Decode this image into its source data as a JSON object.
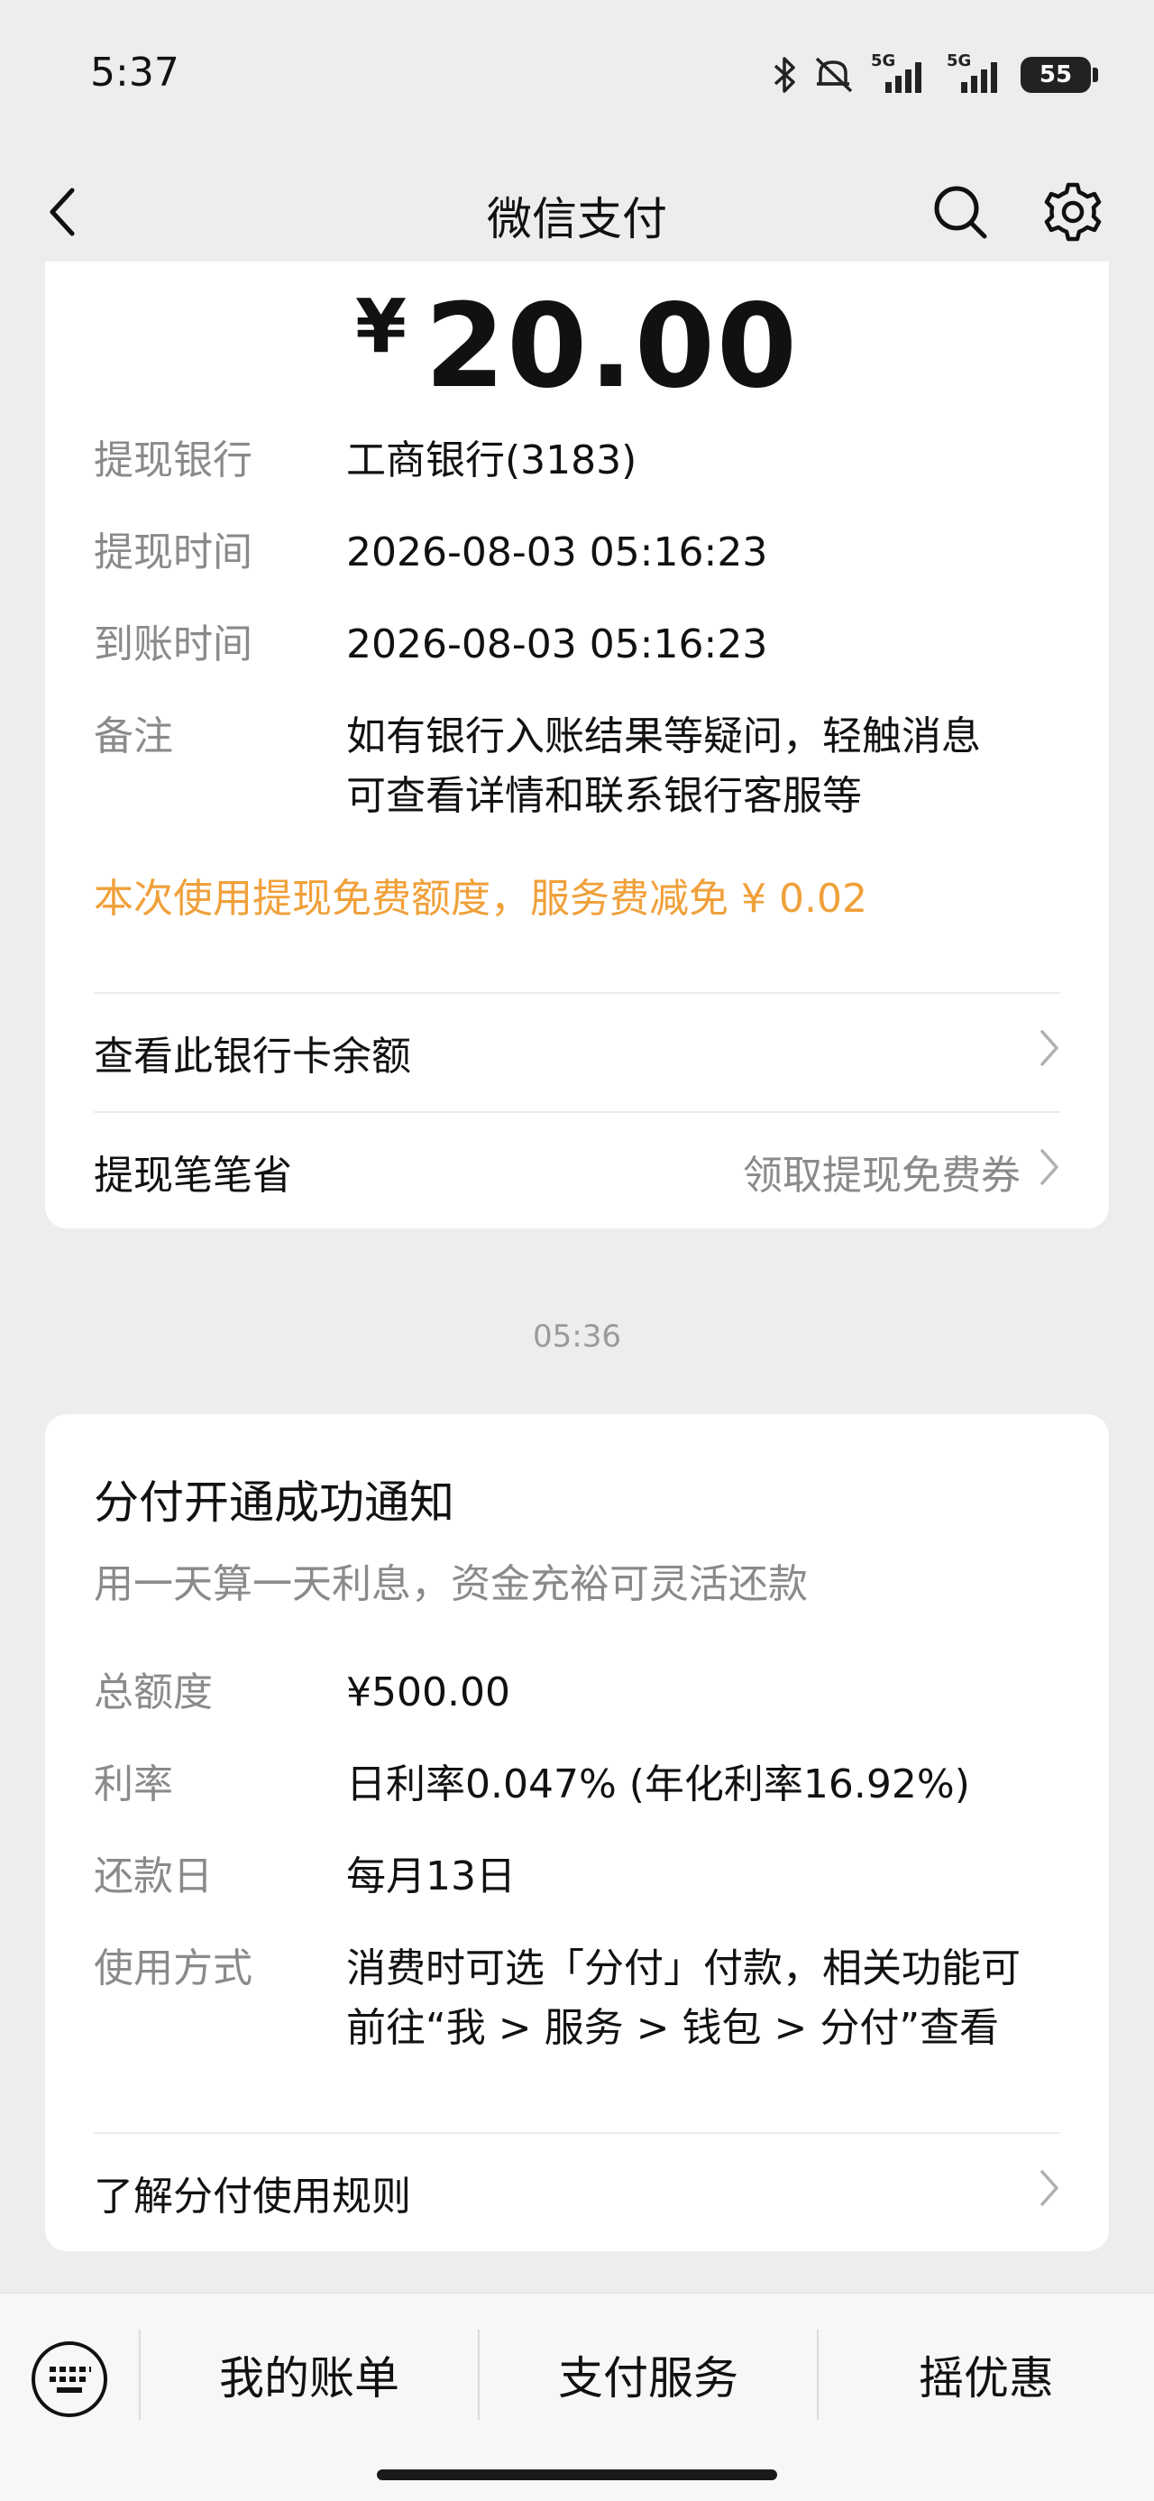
{
  "status_bar": {
    "time": "5:37",
    "battery": "55",
    "icons": [
      "bluetooth-icon",
      "mute-icon",
      "signal-5g-icon",
      "signal-5g-icon",
      "battery-icon"
    ],
    "signal_label": "5G"
  },
  "nav": {
    "title": "微信支付",
    "icons": [
      "back-icon",
      "search-icon",
      "gear-icon"
    ]
  },
  "withdraw_card": {
    "currency_symbol": "¥",
    "amount": "20.00",
    "rows": [
      {
        "label": "提现银行",
        "value": "工商银行(3183)"
      },
      {
        "label": "提现时间",
        "value": "2026-08-03 05:16:23"
      },
      {
        "label": "到账时间",
        "value": "2026-08-03 05:16:23"
      },
      {
        "label": "备注",
        "value_line1": "如有银行入账结果等疑问，轻触消息",
        "value_line2": "可查看详情和联系银行客服等"
      }
    ],
    "notice": "本次使用提现免费额度，服务费减免 ¥ 0.02",
    "notice_color": "#f0a03a",
    "link_balance": "查看此银行卡余额",
    "link_saver": "提现笔笔省",
    "link_saver_right": "领取提现免费券"
  },
  "timestamp": "05:36",
  "fenfu_card": {
    "title": "分付开通成功通知",
    "subtitle": "用一天算一天利息，资金充裕可灵活还款",
    "rows": [
      {
        "label": "总额度",
        "value": "¥500.00"
      },
      {
        "label": "利率",
        "value": "日利率0.047% (年化利率16.92%)"
      },
      {
        "label": "还款日",
        "value": "每月13日"
      },
      {
        "label": "使用方式",
        "value_line1": "消费时可选「分付」付款，相关功能可",
        "value_line2": "前往“我 > 服务 > 钱包 > 分付”查看"
      }
    ],
    "link_rules": "了解分付使用规则"
  },
  "tab_bar": {
    "keyboard_icon": "keyboard-icon",
    "items": [
      "我的账单",
      "支付服务",
      "摇优惠"
    ]
  },
  "colors": {
    "background": "#ededed",
    "card": "#ffffff",
    "label_gray": "#8a8a8a",
    "accent_orange": "#f0a03a"
  }
}
